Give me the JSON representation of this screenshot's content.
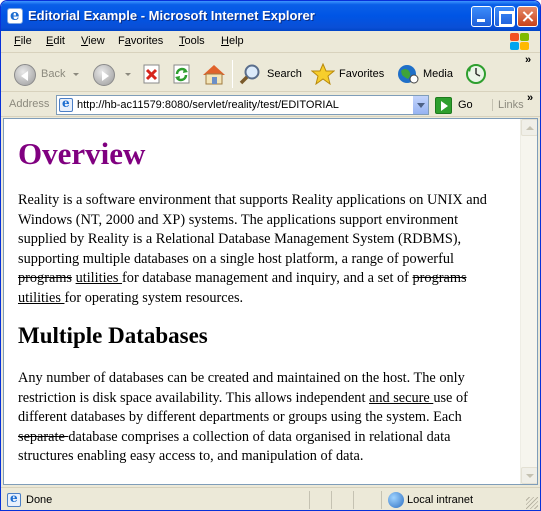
{
  "window": {
    "title": "Editorial Example - Microsoft Internet Explorer"
  },
  "menu": [
    {
      "label": "File",
      "u": "F",
      "rest": "ile"
    },
    {
      "label": "Edit",
      "u": "E",
      "rest": "dit"
    },
    {
      "label": "View",
      "u": "V",
      "rest": "iew"
    },
    {
      "label": "Favorites",
      "u": "a",
      "pre": "F",
      "rest": "vorites"
    },
    {
      "label": "Tools",
      "u": "T",
      "rest": "ools"
    },
    {
      "label": "Help",
      "u": "H",
      "rest": "elp"
    }
  ],
  "toolbar": {
    "back_label": "Back",
    "search_label": "Search",
    "favorites_label": "Favorites",
    "media_label": "Media"
  },
  "address": {
    "label": "Address",
    "url": "http://hb-ac11579:8080/servlet/reality/test/EDITORIAL",
    "go_label": "Go",
    "links_label": "Links"
  },
  "page": {
    "h1": "Overview",
    "p1": [
      [
        {
          "t": "Reality is a software environment that supports Reality applications on UNIX and"
        }
      ],
      [
        {
          "t": "Windows (NT, 2000 and XP) systems. The applications support environment"
        }
      ],
      [
        {
          "t": "supplied by Reality is a Relational Database Management System (RDBMS),"
        }
      ],
      [
        {
          "t": "supporting multiple databases on a single host platform, a range of powerful"
        }
      ],
      [
        {
          "t": "programs",
          "s": "del"
        },
        {
          "t": " "
        },
        {
          "t": "utilities ",
          "s": "ins"
        },
        {
          "t": "for database management and inquiry, and a set of "
        },
        {
          "t": "programs",
          "s": "del"
        }
      ],
      [
        {
          "t": "utilities ",
          "s": "ins"
        },
        {
          "t": "for operating system resources."
        }
      ]
    ],
    "h2": "Multiple Databases",
    "p2": [
      [
        {
          "t": "Any number of databases can be created and maintained on the host. The only"
        }
      ],
      [
        {
          "t": "restriction is disk space availability. This allows independent "
        },
        {
          "t": "and secure ",
          "s": "ins"
        },
        {
          "t": "use of"
        }
      ],
      [
        {
          "t": "different databases by different departments or groups using the system. Each"
        }
      ],
      [
        {
          "t": "separate ",
          "s": "del"
        },
        {
          "t": "database comprises a collection of data organised in relational data"
        }
      ],
      [
        {
          "t": "structures enabling easy access to, and manipulation of data."
        }
      ]
    ]
  },
  "status": {
    "text": "Done",
    "zone": "Local intranet"
  },
  "colors": {
    "heading": "#800080",
    "titlebar": "#0055E5",
    "chrome": "#ECE9D8"
  }
}
